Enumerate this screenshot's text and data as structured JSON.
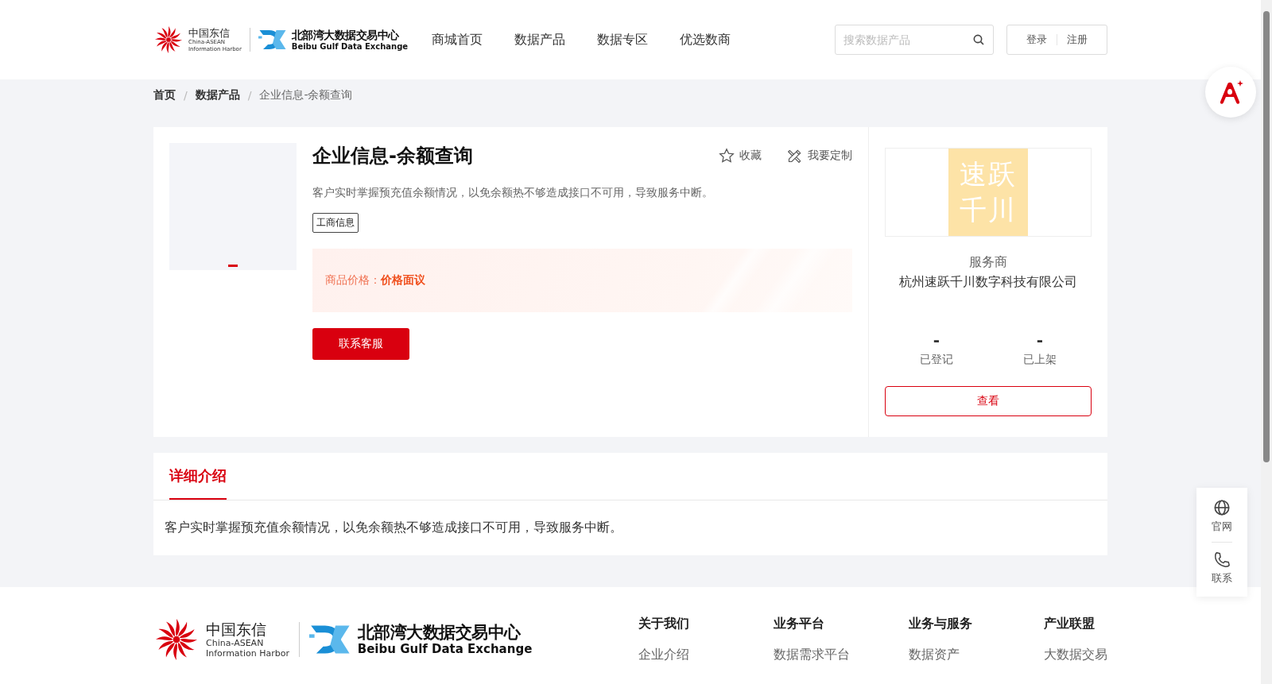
{
  "header": {
    "logo": {
      "cn": "中国东信",
      "en1": "China-ASEAN",
      "en2": "Information Harbor",
      "cn2": "北部湾大数据交易中心",
      "en3": "Beibu Gulf Data Exchange"
    },
    "nav": [
      {
        "label": "商城首页",
        "selected": false
      },
      {
        "label": "数据产品",
        "selected": false
      },
      {
        "label": "数据专区",
        "selected": false
      },
      {
        "label": "优选数商",
        "selected": false
      }
    ],
    "search": {
      "placeholder": "搜索数据产品"
    },
    "auth": [
      "登录",
      "注册"
    ]
  },
  "breadcrumb": [
    "首页",
    "数据产品",
    "企业信息-余额查询"
  ],
  "breadcrumb_separator": "/",
  "product": {
    "title": "企业信息-余额查询",
    "actions": [
      {
        "label": "收藏",
        "kind": "star"
      },
      {
        "label": "我要定制",
        "kind": "custom"
      }
    ],
    "description": "客户实时掌握预充值余额情况，以免余额热不够造成接口不可用，导致服务中断。",
    "tags": [
      "工商信息"
    ],
    "price_label": "商品价格：",
    "price_value": "价格面议",
    "contact_button": "联系客服"
  },
  "provider": {
    "logo_lines": [
      "速跃",
      "千川"
    ],
    "role": "服务商",
    "name": "杭州速跃千川数字科技有限公司",
    "stats": [
      {
        "value": "-",
        "label": "已登记"
      },
      {
        "value": "-",
        "label": "已上架"
      }
    ],
    "view_button": "查看"
  },
  "detail": {
    "tabs": [
      {
        "label": "详细介绍",
        "selected": true
      }
    ],
    "text": "客户实时掌握预充值余额情况，以免余额热不够造成接口不可用，导致服务中断。"
  },
  "footer": {
    "logo": {
      "cn": "中国东信",
      "en1": "China-ASEAN",
      "en2": "Information Harbor",
      "cn2": "北部湾大数据交易中心",
      "en3": "Beibu Gulf Data Exchange"
    },
    "columns": [
      {
        "title": "关于我们",
        "links": [
          "企业介绍"
        ]
      },
      {
        "title": "业务平台",
        "links": [
          "数据需求平台"
        ]
      },
      {
        "title": "业务与服务",
        "links": [
          "数据资产"
        ]
      },
      {
        "title": "产业联盟",
        "links": [
          "大数据交易"
        ]
      }
    ]
  },
  "side_panel": [
    {
      "label": "官网",
      "kind": "globe"
    },
    {
      "label": "联系",
      "kind": "phone"
    }
  ]
}
